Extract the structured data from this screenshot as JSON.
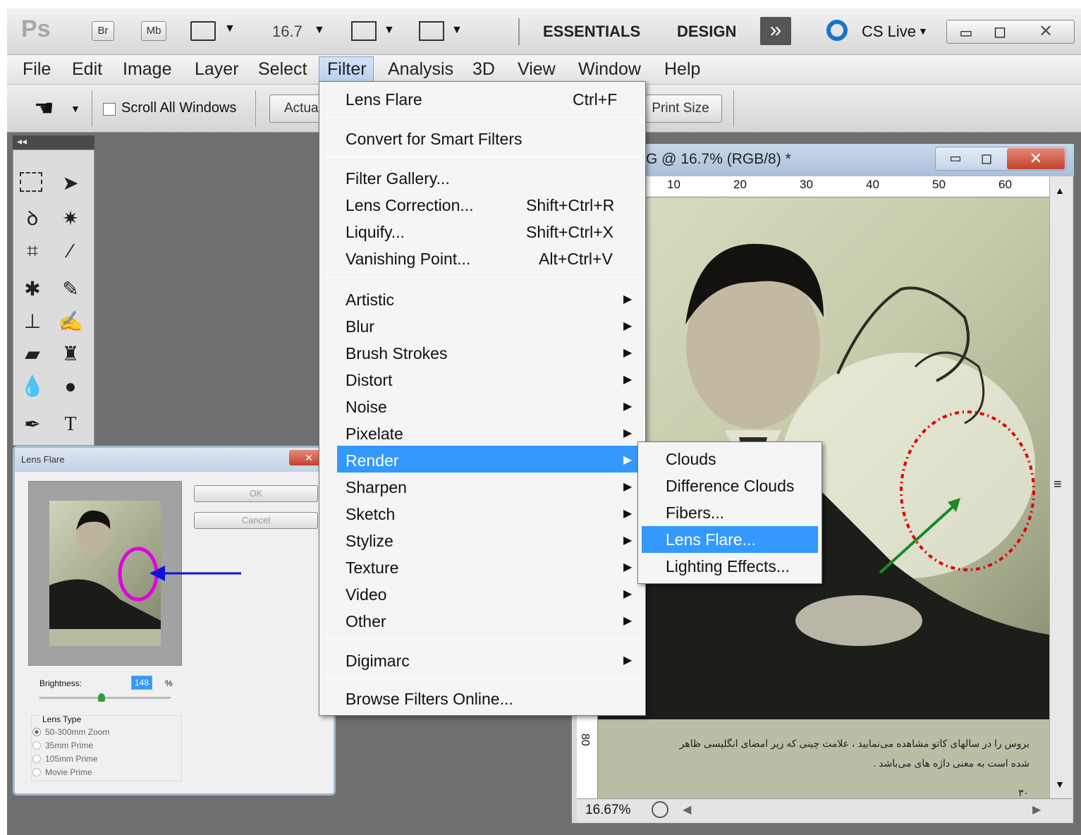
{
  "appbar": {
    "logo": "Ps",
    "br": "Br",
    "mb": "Mb",
    "zoom": "16.7",
    "essentials": "ESSENTIALS",
    "design": "DESIGN",
    "more": "»",
    "cslive": "CS Live"
  },
  "menubar": [
    "File",
    "Edit",
    "Image",
    "Layer",
    "Select",
    "Filter",
    "Analysis",
    "3D",
    "View",
    "Window",
    "Help"
  ],
  "options": {
    "scroll_all": "Scroll All Windows",
    "actual": "Actua",
    "print_size": "Print Size"
  },
  "filter_menu": {
    "last_filter": "Lens Flare",
    "last_filter_shortcut": "Ctrl+F",
    "convert": "Convert for Smart Filters",
    "gallery": "Filter Gallery...",
    "lens_correction": "Lens Correction...",
    "lens_correction_sc": "Shift+Ctrl+R",
    "liquify": "Liquify...",
    "liquify_sc": "Shift+Ctrl+X",
    "vanishing": "Vanishing Point...",
    "vanishing_sc": "Alt+Ctrl+V",
    "groups": [
      "Artistic",
      "Blur",
      "Brush Strokes",
      "Distort",
      "Noise",
      "Pixelate",
      "Render",
      "Sharpen",
      "Sketch",
      "Stylize",
      "Texture",
      "Video",
      "Other"
    ],
    "digimarc": "Digimarc",
    "browse": "Browse Filters Online..."
  },
  "render_submenu": [
    "Clouds",
    "Difference Clouds",
    "Fibers...",
    "Lens Flare...",
    "Lighting Effects..."
  ],
  "document": {
    "title": "G @ 16.7% (RGB/8) *",
    "ruler": [
      "10",
      "20",
      "30",
      "40",
      "50",
      "60"
    ],
    "vruler": "80",
    "zoom": "16.67%",
    "caption_line1": "بروس را در سالهای کاتو مشاهده می‌نمایید ، علامت چینی که زیر امضای انگلیسی ظاهر",
    "caption_line2": "شده است به معنی داژه های می‌باشد .",
    "page_no": "۳۰"
  },
  "dialog": {
    "title": "Lens Flare",
    "ok": "OK",
    "cancel": "Cancel",
    "brightness_label": "Brightness:",
    "brightness_value": "148",
    "percent": "%",
    "lens_type": "Lens Type",
    "lenses": [
      "50-300mm Zoom",
      "35mm Prime",
      "105mm Prime",
      "Movie Prime"
    ]
  },
  "colors": {
    "highlight": "#3399ff",
    "annotation_red": "#e00000",
    "annotation_green": "#1a8a2a",
    "annotation_blue": "#1010e0",
    "annotation_magenta": "#e000e0"
  }
}
